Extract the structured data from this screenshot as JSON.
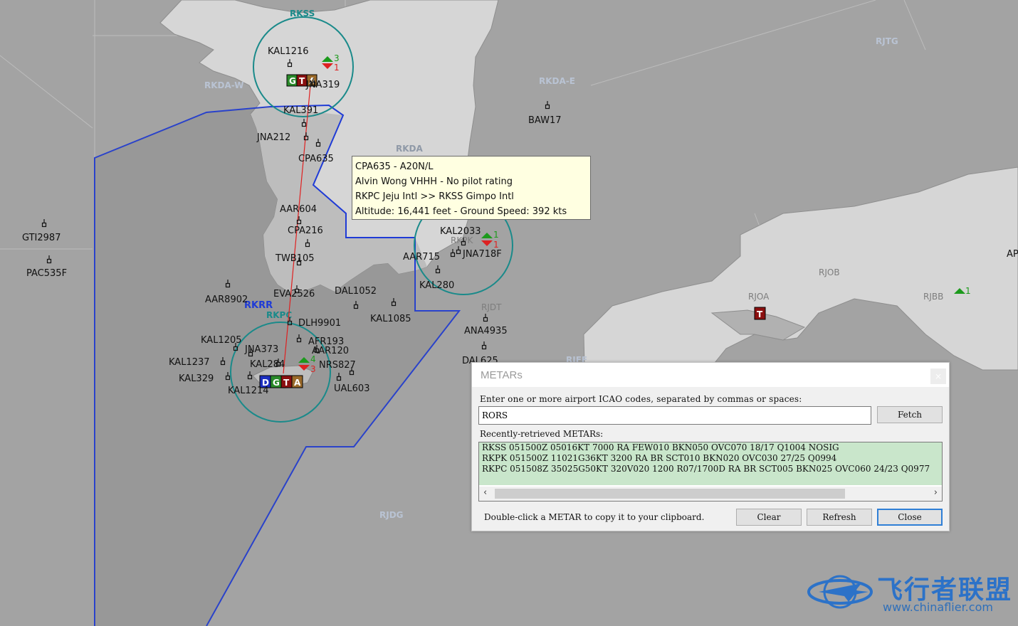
{
  "map": {
    "sectors": [
      {
        "id": "rkss",
        "label": "RKSS"
      },
      {
        "id": "rkda_w",
        "label": "RKDA-W"
      },
      {
        "id": "rkda_e",
        "label": "RKDA-E"
      },
      {
        "id": "rkda",
        "label": "RKDA"
      },
      {
        "id": "rjtg",
        "label": "RJTG"
      },
      {
        "id": "rkrr",
        "label": "RKRR"
      },
      {
        "id": "rkpk_top",
        "label": "RKPK"
      },
      {
        "id": "rkpc_top",
        "label": "RKPC"
      },
      {
        "id": "rjdt",
        "label": "RJDT"
      },
      {
        "id": "rjob",
        "label": "RJOB"
      },
      {
        "id": "rjoa",
        "label": "RJOA"
      },
      {
        "id": "rjbb",
        "label": "RJBB"
      },
      {
        "id": "rjdg",
        "label": "RJDG"
      },
      {
        "id": "rjff",
        "label": "RJFF"
      },
      {
        "id": "ap",
        "label": "AP"
      }
    ],
    "airports": {
      "rkss": {
        "arrivals": "3",
        "departures": "1",
        "badges": [
          "G",
          "T",
          "A"
        ]
      },
      "rkpk": {
        "arrivals": "1",
        "departures": "1"
      },
      "rkpc": {
        "arrivals": "4",
        "departures": "3",
        "badges": [
          "D",
          "G",
          "T",
          "A"
        ]
      },
      "rjoa": {
        "badges": [
          "T"
        ]
      },
      "rjbb": {
        "arrivals": "1"
      }
    },
    "aircraft": [
      {
        "id": "kal1216",
        "callsign": "KAL1216"
      },
      {
        "id": "jna319",
        "callsign": "JNA319"
      },
      {
        "id": "kal391",
        "callsign": "KAL391"
      },
      {
        "id": "jna212",
        "callsign": "JNA212"
      },
      {
        "id": "cpa635",
        "callsign": "CPA635"
      },
      {
        "id": "aar604",
        "callsign": "AAR604"
      },
      {
        "id": "cpa216",
        "callsign": "CPA216"
      },
      {
        "id": "twb105",
        "callsign": "TWB105"
      },
      {
        "id": "aar8902",
        "callsign": "AAR8902"
      },
      {
        "id": "eva2526",
        "callsign": "EVA2526"
      },
      {
        "id": "dal1052",
        "callsign": "DAL1052"
      },
      {
        "id": "kal1085",
        "callsign": "KAL1085"
      },
      {
        "id": "dlh9901",
        "callsign": "DLH9901"
      },
      {
        "id": "afr193",
        "callsign": "AFR193"
      },
      {
        "id": "aar120",
        "callsign": "AAR120"
      },
      {
        "id": "kal1205",
        "callsign": "KAL1205"
      },
      {
        "id": "jna373",
        "callsign": "JNA373"
      },
      {
        "id": "kal1237",
        "callsign": "KAL1237"
      },
      {
        "id": "kal284",
        "callsign": "KAL284"
      },
      {
        "id": "nrs827",
        "callsign": "NRS827"
      },
      {
        "id": "kal329",
        "callsign": "KAL329"
      },
      {
        "id": "kal1214",
        "callsign": "KAL1214"
      },
      {
        "id": "ual603",
        "callsign": "UAL603"
      },
      {
        "id": "kal2033",
        "callsign": "KAL2033"
      },
      {
        "id": "aar715",
        "callsign": "AAR715"
      },
      {
        "id": "jna718f",
        "callsign": "JNA718F"
      },
      {
        "id": "kal280",
        "callsign": "KAL280"
      },
      {
        "id": "baw17",
        "callsign": "BAW17"
      },
      {
        "id": "gti2987",
        "callsign": "GTI2987"
      },
      {
        "id": "pac535f",
        "callsign": "PAC535F"
      },
      {
        "id": "ana4935",
        "callsign": "ANA4935"
      },
      {
        "id": "dal625",
        "callsign": "DAL625"
      }
    ],
    "tooltip": {
      "line1": "CPA635 - A20N/L",
      "line2": "Alvin Wong VHHH - No pilot rating",
      "line3": "RKPC Jeju Intl  >>  RKSS Gimpo Intl",
      "line4": "Altitude: 16,441 feet - Ground Speed: 392 kts"
    },
    "colors": {
      "fir_boundary": "#1f3bd6",
      "airport_ring": "#1a8a8a",
      "flight_route": "#e02020",
      "tooltip_bg": "#ffffe1"
    }
  },
  "metar": {
    "title": "METARs",
    "close_x": "×",
    "instructions": "Enter one or more airport ICAO codes, separated by commas or spaces:",
    "input_value": "RORS",
    "fetch": "Fetch",
    "recent_label": "Recently-retrieved METARs:",
    "rows": [
      "RKSS 051500Z 05016KT 7000 RA FEW010 BKN050 OVC070 18/17 Q1004 NOSIG",
      "RKPK 051500Z 11021G36KT 3200 RA BR SCT010 BKN020 OVC030 27/25 Q0994",
      "RKPC 051508Z 35025G50KT 320V020 1200 R07/1700D RA BR SCT005 BKN025 OVC060 24/23 Q0977"
    ],
    "scroll_left": "‹",
    "scroll_right": "›",
    "hint": "Double-click a METAR to copy it to your clipboard.",
    "clear": "Clear",
    "refresh": "Refresh",
    "close": "Close"
  },
  "watermark": {
    "text": "飞行者联盟",
    "url": "www.chinaflier.com"
  }
}
